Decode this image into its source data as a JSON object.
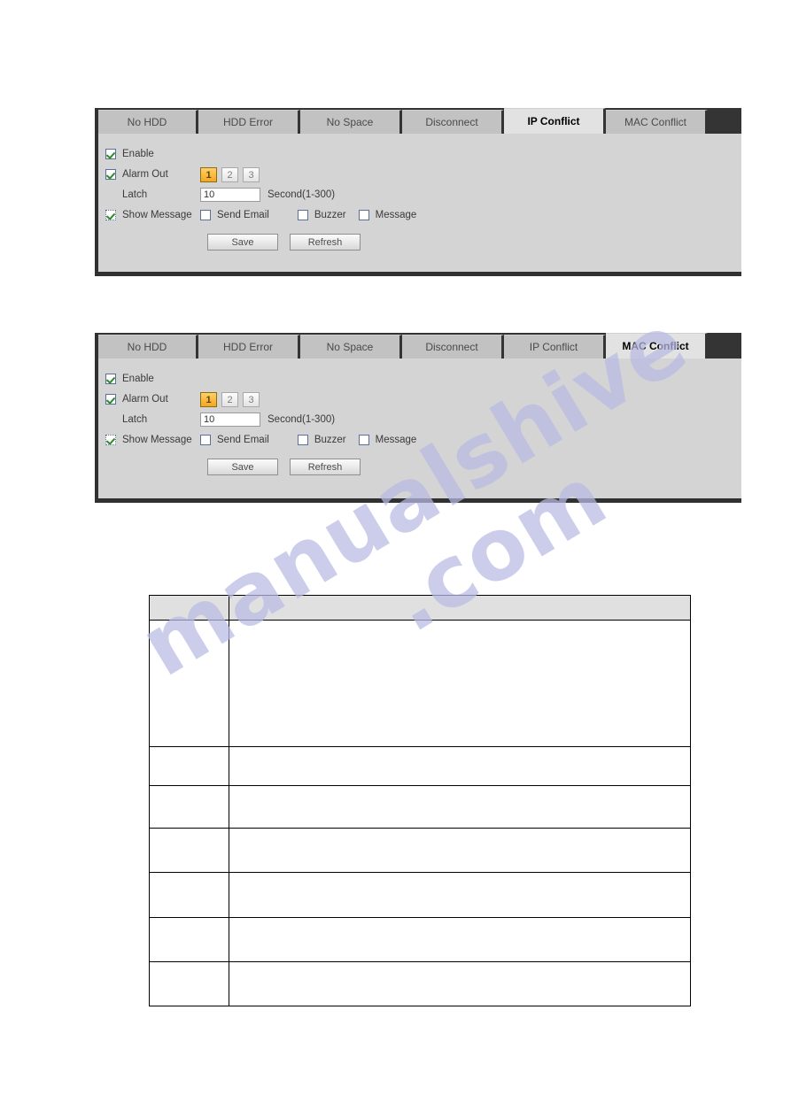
{
  "page": {
    "background_color": "#ffffff",
    "watermark": {
      "line1": "manualshive",
      "line2": ".com"
    }
  },
  "panels": [
    {
      "id": "ip-conflict-panel",
      "tabs": [
        {
          "label": "No HDD",
          "active": false
        },
        {
          "label": "HDD Error",
          "active": false
        },
        {
          "label": "No Space",
          "active": false
        },
        {
          "label": "Disconnect",
          "active": false
        },
        {
          "label": "IP Conflict",
          "active": true
        },
        {
          "label": "MAC Conflict",
          "active": false
        }
      ],
      "form": {
        "enable": {
          "label": "Enable",
          "checked": true
        },
        "alarm_out": {
          "label": "Alarm Out",
          "checked": true,
          "options": [
            "1",
            "2",
            "3"
          ],
          "selected": "1"
        },
        "latch": {
          "label": "Latch",
          "value": "10",
          "placeholder": "10",
          "unit": "Second(1-300)"
        },
        "show_message": {
          "label": "Show Message",
          "checked": true
        },
        "send_email": {
          "label": "Send Email",
          "checked": false
        },
        "buzzer": {
          "label": "Buzzer",
          "checked": false
        },
        "message": {
          "label": "Message",
          "checked": false
        },
        "save_label": "Save",
        "refresh_label": "Refresh"
      }
    },
    {
      "id": "mac-conflict-panel",
      "tabs": [
        {
          "label": "No HDD",
          "active": false
        },
        {
          "label": "HDD Error",
          "active": false
        },
        {
          "label": "No Space",
          "active": false
        },
        {
          "label": "Disconnect",
          "active": false
        },
        {
          "label": "IP Conflict",
          "active": false
        },
        {
          "label": "MAC Conflict",
          "active": true
        }
      ],
      "form": {
        "enable": {
          "label": "Enable",
          "checked": true
        },
        "alarm_out": {
          "label": "Alarm Out",
          "checked": true,
          "options": [
            "1",
            "2",
            "3"
          ],
          "selected": "1"
        },
        "latch": {
          "label": "Latch",
          "value": "10",
          "placeholder": "10",
          "unit": "Second(1-300)"
        },
        "show_message": {
          "label": "Show Message",
          "checked": true
        },
        "send_email": {
          "label": "Send Email",
          "checked": false
        },
        "buzzer": {
          "label": "Buzzer",
          "checked": false
        },
        "message": {
          "label": "Message",
          "checked": false
        },
        "save_label": "Save",
        "refresh_label": "Refresh"
      }
    }
  ],
  "spec_table": {
    "headers": [
      "",
      ""
    ],
    "rows": [
      {
        "param": "",
        "desc": "",
        "height": 143
      },
      {
        "param": "",
        "desc": "",
        "height": 44,
        "thick_top": false
      },
      {
        "param": "",
        "desc": "",
        "height": 48,
        "thick_top": true
      },
      {
        "param": "",
        "desc": "",
        "height": 50,
        "thick_top": false
      },
      {
        "param": "",
        "desc": "",
        "height": 51,
        "thick_top": true
      },
      {
        "param": "",
        "desc": "",
        "height": 50,
        "thick_top": false
      },
      {
        "param": "",
        "desc": "",
        "height": 50,
        "thick_top": false
      }
    ]
  }
}
